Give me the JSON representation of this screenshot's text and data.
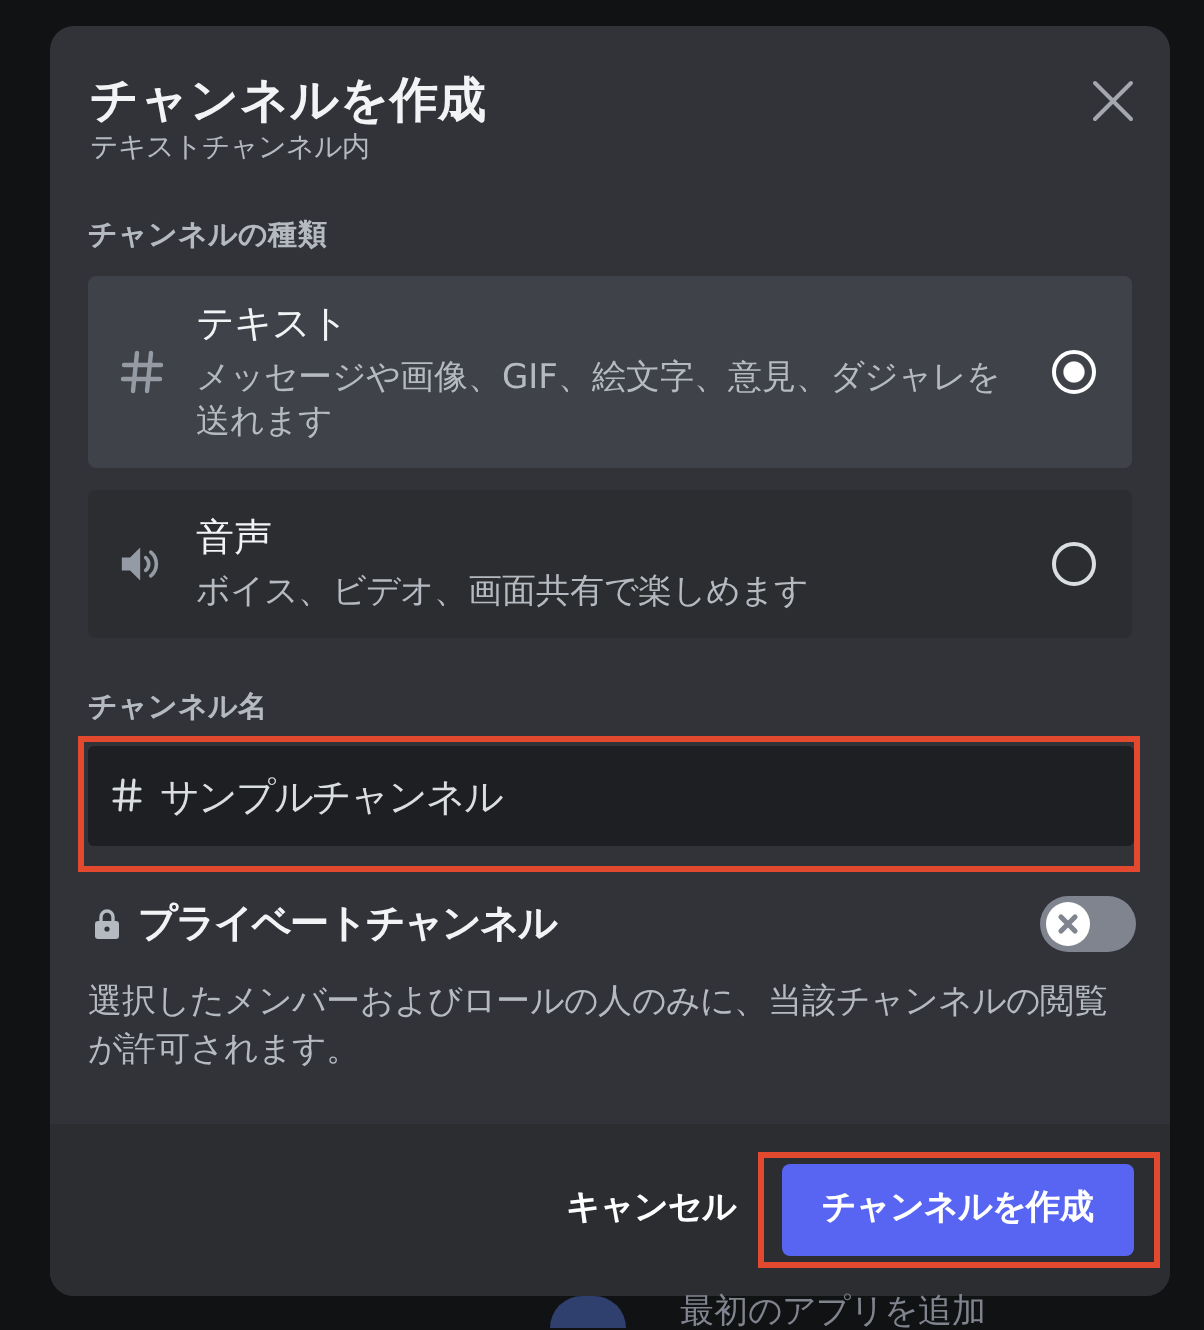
{
  "dialog": {
    "title": "チャンネルを作成",
    "subtitle": "テキストチャンネル内",
    "channel_type": {
      "label": "チャンネルの種類",
      "options": [
        {
          "kind": "text",
          "title": "テキスト",
          "description": "メッセージや画像、GIF、絵文字、意見、ダジャレを送れます",
          "selected": true
        },
        {
          "kind": "voice",
          "title": "音声",
          "description": "ボイス、ビデオ、画面共有で楽しめます",
          "selected": false
        }
      ]
    },
    "channel_name": {
      "label": "チャンネル名",
      "value": "サンプルチャンネル",
      "highlighted": true
    },
    "private": {
      "label": "プライベートチャンネル",
      "on": false,
      "description": "選択したメンバーおよびロールの人のみに、当該チャンネルの閲覧が許可されます。"
    },
    "footer": {
      "cancel": "キャンセル",
      "submit": {
        "label": "チャンネルを作成",
        "highlighted": true
      }
    }
  },
  "background": {
    "app_label": "最初のアプリを追加"
  }
}
